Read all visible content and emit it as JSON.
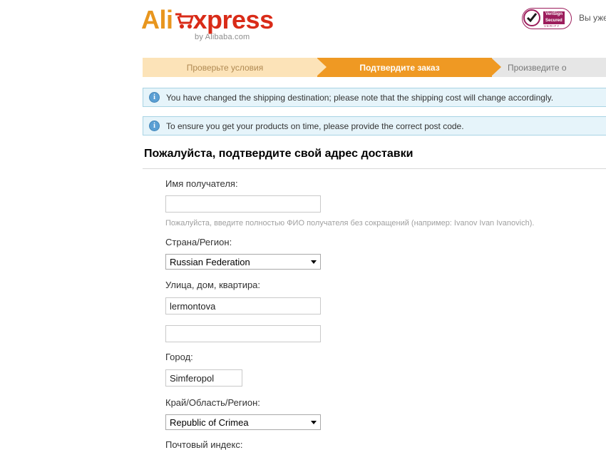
{
  "header": {
    "logo": {
      "ali": "Ali",
      "x": "E",
      "press": "xpress",
      "cart_icon": "shopping-cart-icon",
      "subtitle": "by Alibaba.com"
    },
    "verisign": {
      "line1": "VeriSign",
      "line2": "Secured",
      "line3": "VERIFY",
      "check_icon": "checkmark-icon"
    },
    "greeting": "Вы уже в"
  },
  "steps": [
    {
      "label": "Проверьте условия",
      "state": "completed"
    },
    {
      "label": "Подтвердите заказ",
      "state": "active"
    },
    {
      "label": "Произведите о",
      "state": "upcoming"
    }
  ],
  "notices": [
    {
      "icon": "info-icon",
      "text": "You have changed the shipping destination; please note that the shipping cost will change accordingly."
    },
    {
      "icon": "info-icon",
      "text": "To ensure you get your products on time, please provide the correct post code."
    }
  ],
  "main": {
    "title": "Пожалуйста, подтвердите свой адрес доставки",
    "fields": {
      "recipient": {
        "label": "Имя получателя:",
        "value": "",
        "placeholder": "",
        "hint": "Пожалуйста, введите полностью ФИО получателя без сокращений (например: Ivanov Ivan Ivanovich)."
      },
      "country": {
        "label": "Страна/Регион:",
        "value": "Russian Federation"
      },
      "street": {
        "label": "Улица, дом, квартира:",
        "value_line1": "lermontova",
        "value_line2": "",
        "placeholder": ""
      },
      "city": {
        "label": "Город:",
        "value": "Simferopol",
        "placeholder": ""
      },
      "region": {
        "label": "Край/Область/Регион:",
        "value": "Republic of Crimea"
      },
      "zip": {
        "label": "Почтовый индекс:"
      }
    }
  },
  "colors": {
    "brand_orange": "#e8961e",
    "brand_red": "#d92b18",
    "step_active": "#ef9923",
    "step_done": "#fce3b8",
    "step_upcoming": "#e6e6e6",
    "notice_bg": "#e6f4fa",
    "notice_border": "#a8d4e4",
    "verisign": "#9c1d5c"
  }
}
